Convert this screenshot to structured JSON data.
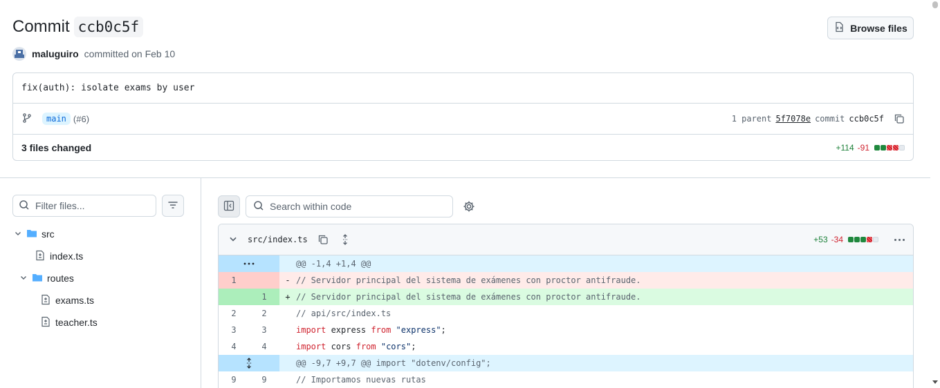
{
  "header": {
    "commit_word": "Commit",
    "commit_sha": "ccb0c5f",
    "browse_label": "Browse files"
  },
  "byline": {
    "author": "maluguiro",
    "action": "committed on Feb 10"
  },
  "commit_box": {
    "message": "fix(auth): isolate exams by user",
    "branch": "main",
    "pr_ref": "(#6)",
    "parent_label": "1 parent",
    "parent_sha": "5f7078e",
    "commit_label": "commit",
    "commit_sha": "ccb0c5f",
    "files_changed": "3 files changed",
    "additions": "+114",
    "deletions": "-91"
  },
  "file_tree": {
    "filter_placeholder": "Filter files...",
    "items": [
      {
        "type": "folder",
        "label": "src"
      },
      {
        "type": "file",
        "label": "index.ts"
      },
      {
        "type": "folder",
        "label": "routes"
      },
      {
        "type": "file",
        "label": "exams.ts"
      },
      {
        "type": "file",
        "label": "teacher.ts"
      }
    ]
  },
  "diff_toolbar": {
    "search_placeholder": "Search within code"
  },
  "diff_file": {
    "name": "src/index.ts",
    "additions": "+53",
    "deletions": "-34",
    "lines": [
      {
        "type": "hunk",
        "text": "@@ -1,4 +1,4 @@"
      },
      {
        "type": "del",
        "old": "1",
        "new": "",
        "sign": "-",
        "text": "// Servidor principal del sistema de exámenes con proctor antifraude."
      },
      {
        "type": "add",
        "old": "",
        "new": "1",
        "sign": "+",
        "text": "// Servidor principal del sistema de exámenes con proctor antifraude."
      },
      {
        "type": "ctx",
        "old": "2",
        "new": "2",
        "sign": "",
        "text": "// api/src/index.ts"
      },
      {
        "type": "ctx",
        "old": "3",
        "new": "3",
        "sign": "",
        "kw": "import",
        "mid": " express ",
        "kw2": "from",
        "str": " \"express\"",
        "tail": ";"
      },
      {
        "type": "ctx",
        "old": "4",
        "new": "4",
        "sign": "",
        "kw": "import",
        "mid": " cors ",
        "kw2": "from",
        "str": " \"cors\"",
        "tail": ";"
      },
      {
        "type": "hunk2",
        "text": "@@ -9,7 +9,7 @@ import \"dotenv/config\";"
      },
      {
        "type": "ctx",
        "old": "9",
        "new": "9",
        "sign": "",
        "text": "// Importamos nuevas rutas"
      }
    ]
  },
  "colors": {
    "add": "#1a7f37",
    "del": "#cf222e",
    "accent": "#0969da"
  }
}
